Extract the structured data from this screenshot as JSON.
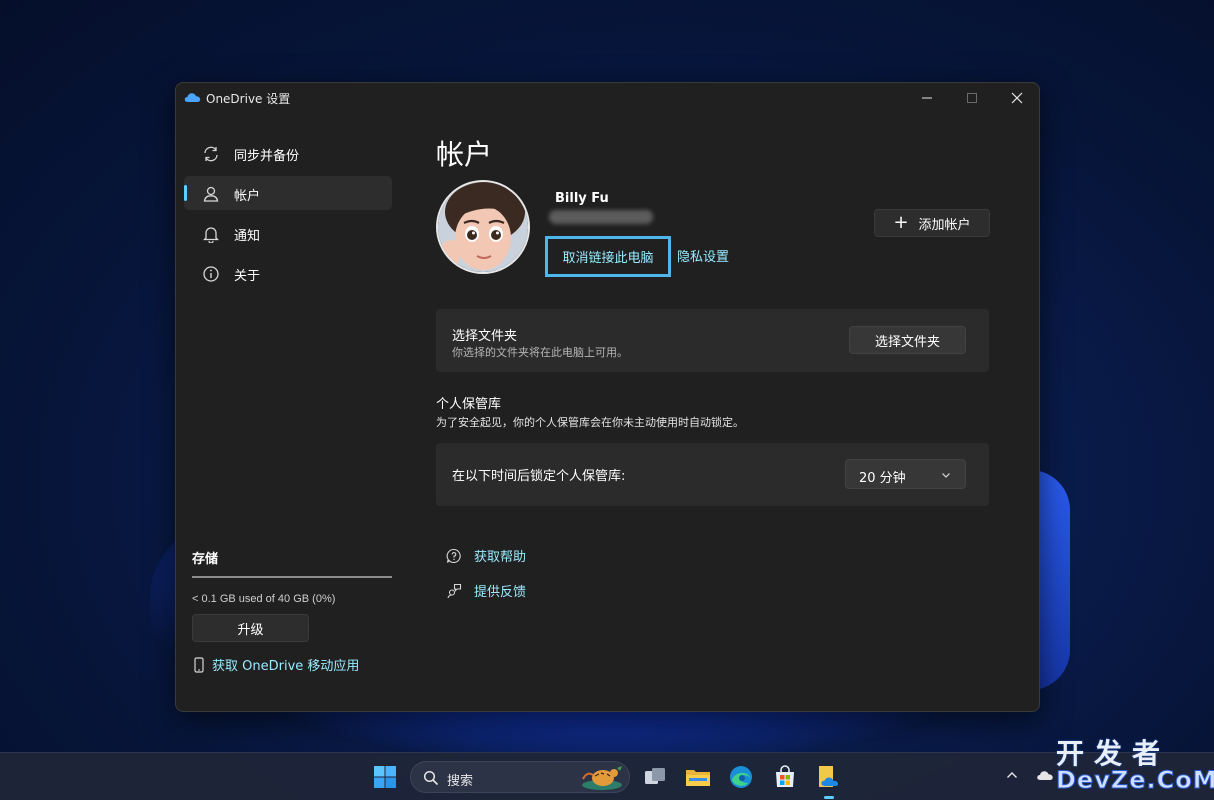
{
  "window": {
    "title": "OneDrive 设置"
  },
  "sidebar": {
    "items": [
      {
        "label": "同步并备份",
        "icon": "sync-icon",
        "active": false
      },
      {
        "label": "帐户",
        "icon": "person-icon",
        "active": true
      },
      {
        "label": "通知",
        "icon": "bell-icon",
        "active": false
      },
      {
        "label": "关于",
        "icon": "info-icon",
        "active": false
      }
    ],
    "storage": {
      "title": "存储",
      "usage": "< 0.1 GB used of 40 GB (0%)",
      "used_fraction": 0.0,
      "upgrade_label": "升级",
      "mobile_app_link": "获取 OneDrive 移动应用"
    }
  },
  "main": {
    "title": "帐户",
    "account": {
      "name": "Billy Fu",
      "unlink_label": "取消链接此电脑",
      "privacy_label": "隐私设置",
      "add_account_label": "添加帐户"
    },
    "folders_card": {
      "title": "选择文件夹",
      "description": "你选择的文件夹将在此电脑上可用。",
      "button_label": "选择文件夹"
    },
    "vault": {
      "title": "个人保管库",
      "description": "为了安全起见，你的个人保管库会在你未主动使用时自动锁定。",
      "lock_label": "在以下时间后锁定个人保管库:",
      "lock_value": "20 分钟"
    },
    "help_link": "获取帮助",
    "feedback_link": "提供反馈"
  },
  "taskbar": {
    "search_label": "搜索"
  },
  "watermark": {
    "line1": "开发者",
    "line2": "DevZe.CoM"
  },
  "colors": {
    "accent": "#60cdff",
    "link": "#99ebff",
    "window_bg": "#202020",
    "card_bg": "#2b2b2b",
    "highlight_border": "#4fb6ec"
  }
}
